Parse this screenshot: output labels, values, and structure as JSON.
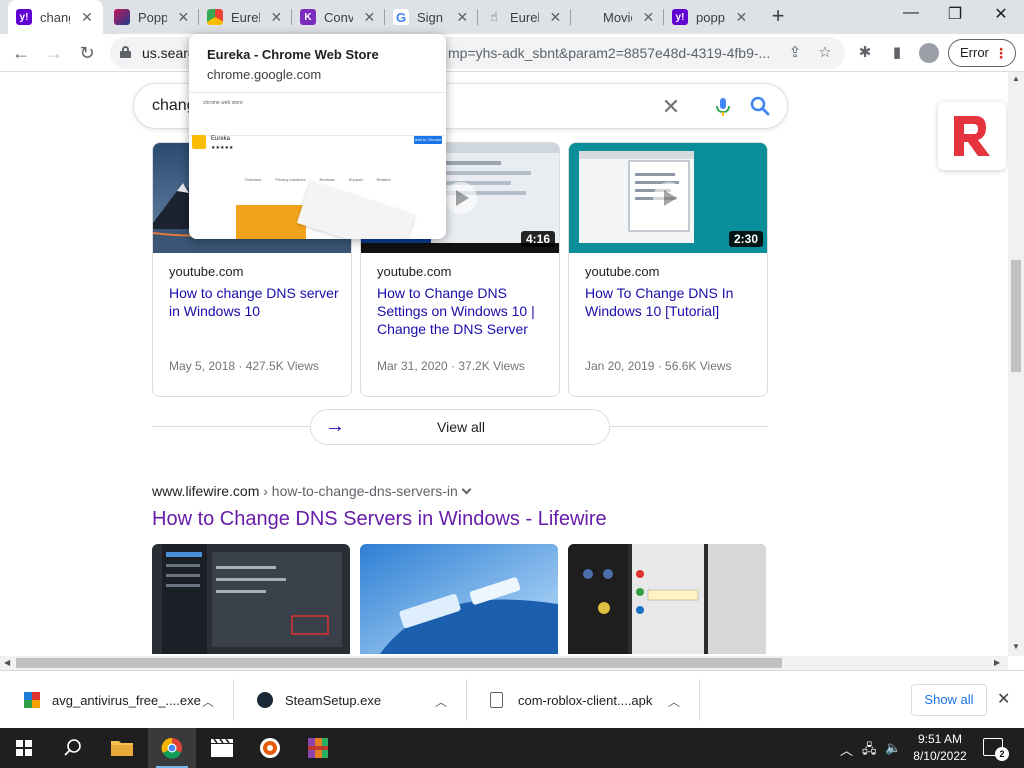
{
  "tabs": [
    {
      "title": "change",
      "favicon": "yahoo-icon",
      "color": "#6001d2",
      "active": true
    },
    {
      "title": "Poppy",
      "favicon": "image-icon",
      "color": "#c2185b"
    },
    {
      "title": "Eureka",
      "favicon": "chrome-webstore-icon",
      "color": "#ea4335"
    },
    {
      "title": "Conv",
      "favicon": "convert-icon",
      "color": "#7b2cbf"
    },
    {
      "title": "Sign",
      "favicon": "google-icon",
      "color": "#4285f4"
    },
    {
      "title": "Eureka",
      "favicon": "eureka-icon",
      "color": "#5f6368"
    },
    {
      "title": "Movie",
      "favicon": "blank-icon",
      "color": "#dee1e6"
    },
    {
      "title": "poppy",
      "favicon": "yahoo-icon",
      "color": "#6001d2"
    }
  ],
  "toolbar": {
    "url_start": "us.search",
    "url_end": "mp=yhs-adk_sbnt&param2=8857e48d-4319-4fb9-...",
    "error_label": "Error",
    "error_dots": "⋮"
  },
  "tab_preview": {
    "title": "Eureka - Chrome Web Store",
    "url": "chrome.google.com",
    "mini_store": "chrome web store",
    "mini_app": "Eureka",
    "mini_button": "Add to Chrome",
    "mini_tabs": [
      "Overview",
      "Privacy practices",
      "Reviews",
      "Support",
      "Related"
    ]
  },
  "search": {
    "query": "change"
  },
  "videos": [
    {
      "source": "youtube.com",
      "title": "How to change DNS server in Windows 10",
      "date": "May 5, 2018 · 427.5K Views",
      "duration": ""
    },
    {
      "source": "youtube.com",
      "title": "How to Change DNS Settings on Windows 10 | Change the DNS Server",
      "date": "Mar 31, 2020 · 37.2K Views",
      "duration": "4:16"
    },
    {
      "source": "youtube.com",
      "title": "How To Change DNS In Windows 10 [Tutorial]",
      "date": "Jan 20, 2019 · 56.6K Views",
      "duration": "2:30"
    }
  ],
  "view_all": "View all",
  "result": {
    "domain": "www.lifewire.com",
    "path": " › how-to-change-dns-servers-in",
    "title": "How to Change DNS Servers in Windows - Lifewire"
  },
  "downloads": [
    {
      "name": "avg_antivirus_free_....exe",
      "icon": "avg-icon"
    },
    {
      "name": "SteamSetup.exe",
      "icon": "steam-icon"
    },
    {
      "name": "com-roblox-client....apk",
      "icon": "file-icon"
    }
  ],
  "show_all": "Show all",
  "clock": {
    "time": "9:51 AM",
    "date": "8/10/2022"
  },
  "notification_count": "2"
}
